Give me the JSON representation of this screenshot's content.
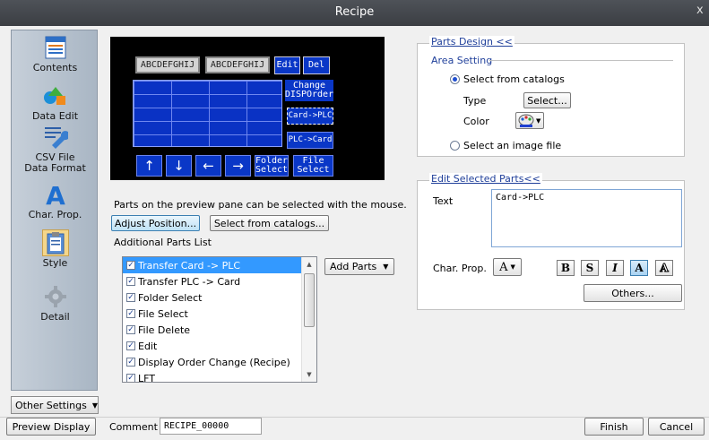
{
  "window": {
    "title": "Recipe",
    "close_label": "x"
  },
  "sidebar": {
    "items": [
      {
        "label": "Contents",
        "icon": "contents-icon"
      },
      {
        "label": "Data Edit",
        "icon": "data-edit-icon"
      },
      {
        "label": "CSV File Data Format",
        "line1": "CSV File",
        "line2": "Data Format",
        "icon": "wrench-icon"
      },
      {
        "label": "Char. Prop.",
        "icon": "letter-a-icon"
      },
      {
        "label": "Style",
        "icon": "clipboard-icon",
        "active": true
      },
      {
        "label": "Detail",
        "icon": "gear-icon"
      }
    ],
    "other_settings": "Other Settings"
  },
  "preview": {
    "key1": "ABCDEFGHIJ",
    "key2": "ABCDEFGHIJ",
    "edit": "Edit",
    "del": "Del",
    "change_line1": "Change",
    "change_line2": "DISPOrder",
    "card_plc": "Card->PLC",
    "plc_card": "PLC->Card",
    "nav": [
      "↑",
      "↓",
      "←",
      "→"
    ],
    "folder_line1": "Folder",
    "folder_line2": "Select",
    "file_line1": "File",
    "file_line2": "Select"
  },
  "main": {
    "hint": "Parts on the preview pane can be selected with the mouse.",
    "adjust_position": "Adjust Position...",
    "select_from_catalogs": "Select from catalogs...",
    "additional_parts_label": "Additional Parts List",
    "add_parts": "Add Parts",
    "parts_list": [
      {
        "label": "Transfer Card -> PLC",
        "checked": true,
        "selected": true
      },
      {
        "label": "Transfer PLC -> Card",
        "checked": true
      },
      {
        "label": "Folder Select",
        "checked": true
      },
      {
        "label": "File Select",
        "checked": true
      },
      {
        "label": "File Delete",
        "checked": true
      },
      {
        "label": "Edit",
        "checked": true
      },
      {
        "label": "Display Order Change (Recipe)",
        "checked": true
      },
      {
        "label": "LFT",
        "checked": true
      }
    ]
  },
  "parts_design": {
    "title": "Parts Design <<",
    "area_setting": "Area Setting",
    "select_from_catalogs": "Select from catalogs",
    "type_label": "Type",
    "type_button": "Select...",
    "color_label": "Color",
    "select_image_file": "Select an image file"
  },
  "edit_selected": {
    "title": "Edit Selected Parts<<",
    "text_label": "Text",
    "text_value": "Card->PLC",
    "char_prop_label": "Char. Prop.",
    "char_prop_value": "A",
    "format_buttons": [
      "B",
      "S",
      "I",
      "A",
      "A"
    ],
    "others": "Others..."
  },
  "footer": {
    "preview_display": "Preview Display",
    "comment_label": "Comment",
    "comment_value": "RECIPE_00000",
    "finish": "Finish",
    "cancel": "Cancel"
  },
  "colors": {
    "preview_blue": "#0a37c7",
    "selection": "#3399ff",
    "link_blue": "#1f3f9a"
  }
}
